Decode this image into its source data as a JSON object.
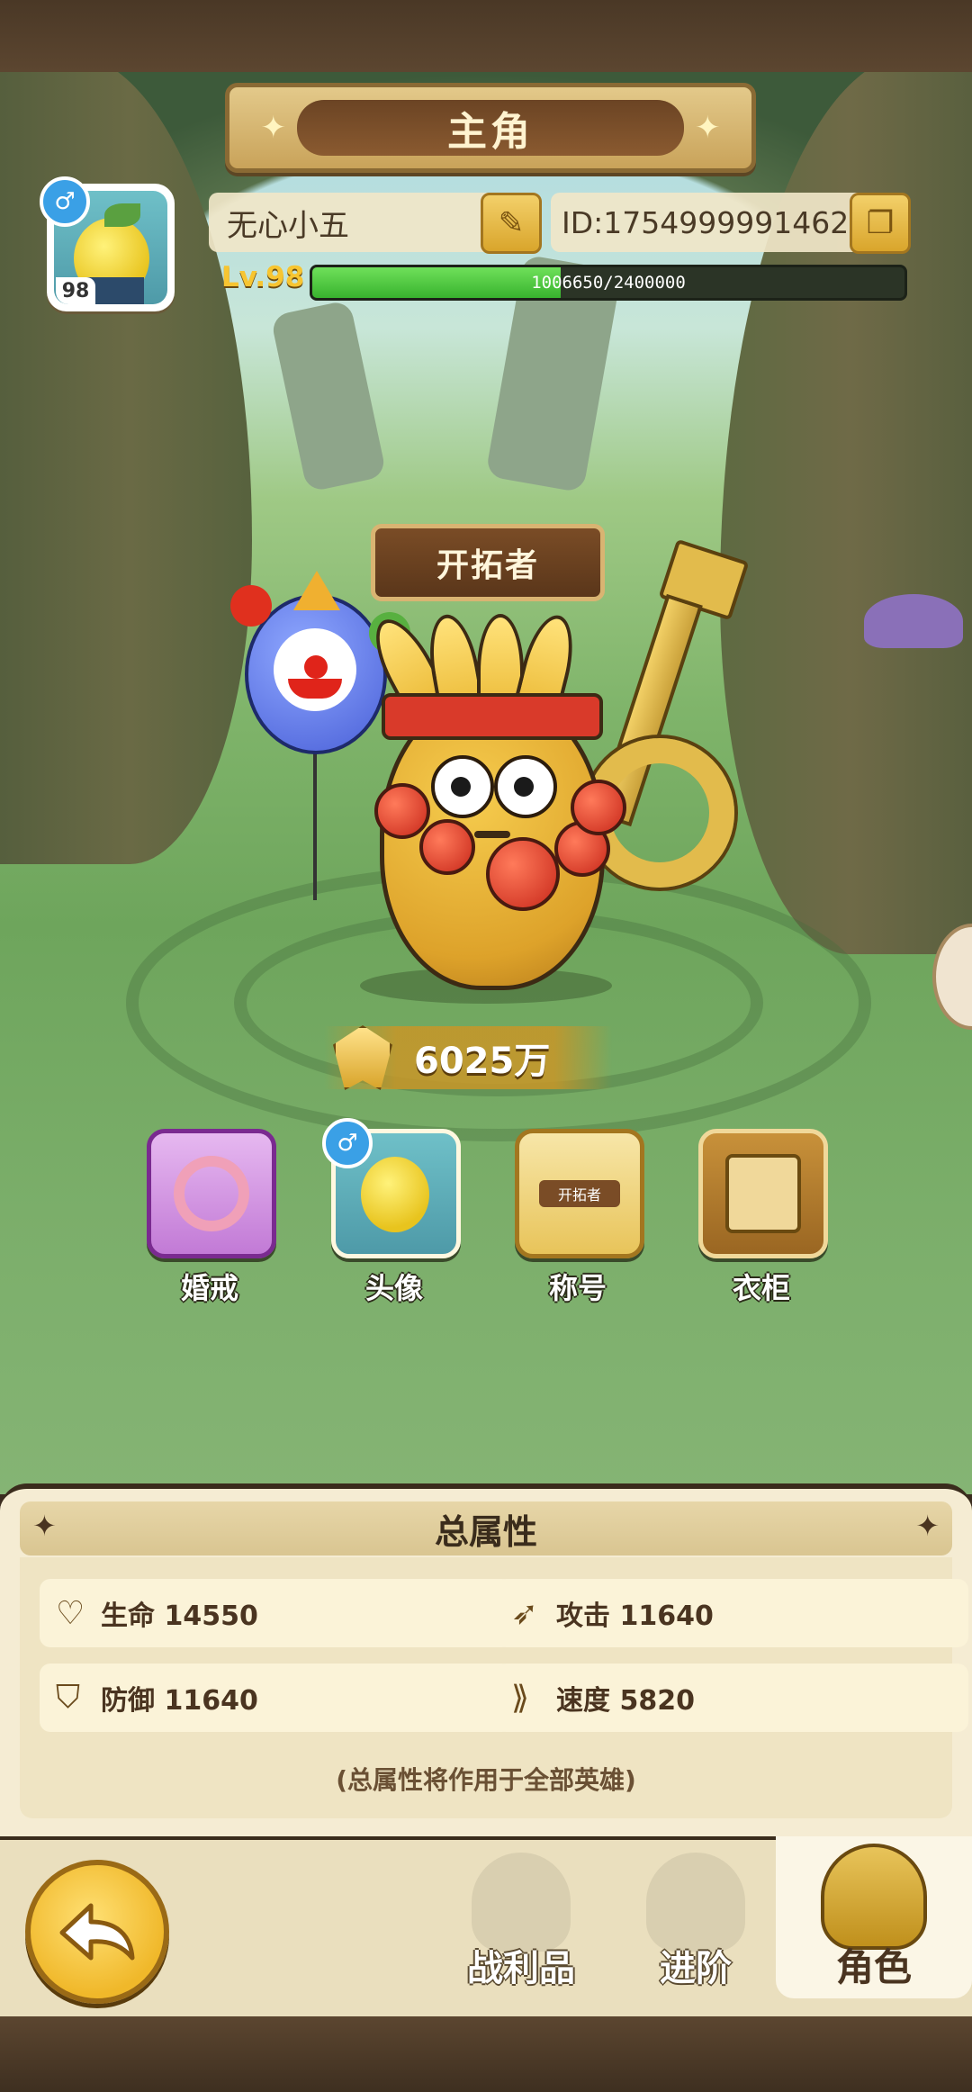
{
  "header": {
    "title": "主角"
  },
  "profile": {
    "avatar_level": "98",
    "gender_icon": "♂",
    "name": "无心小五",
    "id": "ID:1754999991462",
    "level": "Lv.98",
    "exp_text": "1006650/2400000",
    "exp_progress": 0.419
  },
  "character": {
    "title_badge": "开拓者",
    "power": "6025万"
  },
  "menu": [
    {
      "label": "婚戒",
      "icon": "ring-icon"
    },
    {
      "label": "头像",
      "icon": "avatar-icon"
    },
    {
      "label": "称号",
      "icon": "title-badge-icon",
      "badge_text": "开拓者"
    },
    {
      "label": "衣柜",
      "icon": "wardrobe-icon"
    }
  ],
  "stats": {
    "title": "总属性",
    "items": [
      {
        "icon": "heart-icon",
        "label": "生命 14550"
      },
      {
        "icon": "attack-icon",
        "label": "攻击 11640"
      },
      {
        "icon": "shield-icon",
        "label": "防御 11640"
      },
      {
        "icon": "boot-icon",
        "label": "速度 5820"
      }
    ],
    "note": "(总属性将作用于全部英雄)"
  },
  "nav": {
    "tabs": [
      {
        "label": "战利品",
        "icon": "loot-icon"
      },
      {
        "label": "进阶",
        "icon": "advance-icon"
      },
      {
        "label": "角色",
        "icon": "character-icon",
        "active": true
      }
    ]
  },
  "colors": {
    "accent_gold": "#d9a52c",
    "exp_green": "#38b32e",
    "panel_bg": "#f5ecd3",
    "gender_blue": "#3aa0e6"
  }
}
